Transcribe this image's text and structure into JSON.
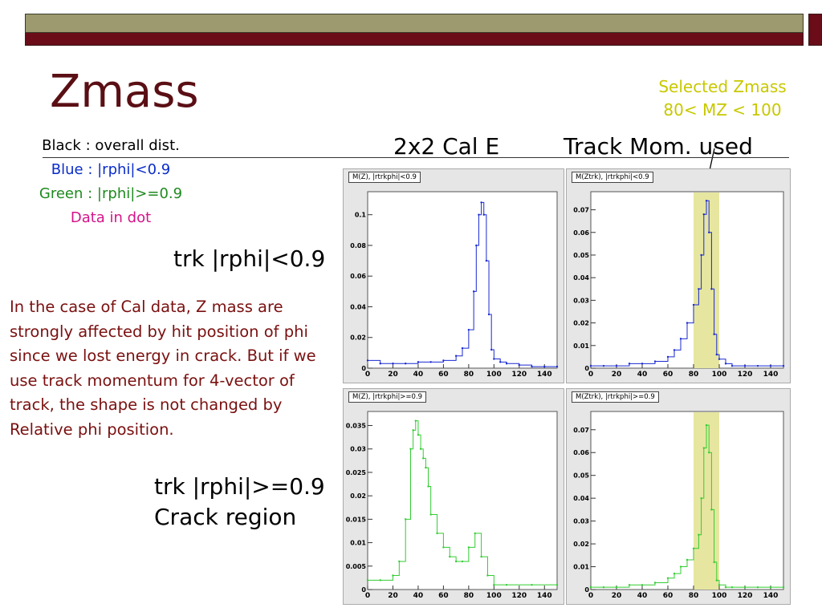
{
  "slide": {
    "title": "Zmass",
    "selected_note": [
      "Selected Zmass",
      "80< MZ < 100"
    ],
    "col1_header": "2x2 Cal E",
    "col2_header": "Track Mom. used",
    "row1_label": "trk |rphi|<0.9",
    "row2_label": [
      "trk |rphi|>=0.9",
      "Crack region"
    ],
    "legend": [
      {
        "text": "Black : overall dist.",
        "color": "#000000"
      },
      {
        "text": "Blue : |rphi|<0.9",
        "color": "#0a2cc8"
      },
      {
        "text": "Green : |rphi|>=0.9",
        "color": "#1f8a1f"
      },
      {
        "text": "Data in dot",
        "color": "#d4148a"
      }
    ],
    "paragraph": "In the case of Cal data, Z mass are strongly affected by hit position of phi since we lost energy in crack. But if we use track momentum for 4-vector of track, the shape is not changed by Relative phi position."
  },
  "colors": {
    "accent": "#5a0f14",
    "blue": "#1a2ad0",
    "green": "#33cc33",
    "band": "#e6e6a0"
  },
  "chart_data": [
    {
      "type": "line",
      "title": "M(Z), |rtrkphi|<0.9",
      "xticks": [
        0,
        20,
        40,
        60,
        80,
        100,
        120,
        140
      ],
      "xlim": [
        0,
        150
      ],
      "yticks": [
        "0",
        "0.02",
        "0.04",
        "0.06",
        "0.08",
        "0.1"
      ],
      "ylim": [
        0,
        0.115
      ],
      "band": null,
      "color": "#1a2ad0",
      "series": [
        {
          "x": [
            0,
            10,
            20,
            30,
            40,
            50,
            60,
            70,
            75,
            80,
            84,
            86,
            88,
            90,
            92,
            94,
            96,
            98,
            100,
            105,
            110,
            120,
            130,
            140,
            150
          ],
          "values": [
            0.005,
            0.003,
            0.003,
            0.003,
            0.004,
            0.004,
            0.005,
            0.008,
            0.013,
            0.025,
            0.05,
            0.08,
            0.1,
            0.108,
            0.1,
            0.07,
            0.035,
            0.012,
            0.006,
            0.004,
            0.003,
            0.002,
            0.001,
            0.001,
            0.001
          ]
        }
      ]
    },
    {
      "type": "line",
      "title": "M(Ztrk), |rtrkphi|<0.9",
      "xticks": [
        0,
        20,
        40,
        60,
        80,
        100,
        120,
        140
      ],
      "xlim": [
        0,
        150
      ],
      "yticks": [
        "0",
        "0.01",
        "0.02",
        "0.03",
        "0.04",
        "0.05",
        "0.06",
        "0.07"
      ],
      "ylim": [
        0,
        0.078
      ],
      "band": [
        80,
        100
      ],
      "color": "#1a2ad0",
      "series": [
        {
          "x": [
            0,
            10,
            20,
            30,
            40,
            50,
            60,
            65,
            70,
            75,
            80,
            84,
            86,
            88,
            90,
            92,
            94,
            96,
            98,
            100,
            105,
            110,
            120,
            130,
            140,
            150
          ],
          "values": [
            0.001,
            0.001,
            0.001,
            0.002,
            0.002,
            0.003,
            0.005,
            0.008,
            0.013,
            0.02,
            0.028,
            0.035,
            0.05,
            0.068,
            0.074,
            0.06,
            0.035,
            0.015,
            0.006,
            0.004,
            0.002,
            0.001,
            0.001,
            0.001,
            0.001,
            0.001
          ]
        }
      ]
    },
    {
      "type": "line",
      "title": "M(Z), |rtrkphi|>=0.9",
      "xticks": [
        0,
        20,
        40,
        60,
        80,
        100,
        120,
        140
      ],
      "xlim": [
        0,
        150
      ],
      "yticks": [
        "0",
        "0.005",
        "0.01",
        "0.015",
        "0.02",
        "0.025",
        "0.03",
        "0.035"
      ],
      "ylim": [
        0,
        0.038
      ],
      "band": null,
      "color": "#33cc33",
      "series": [
        {
          "x": [
            0,
            10,
            20,
            25,
            30,
            34,
            36,
            38,
            40,
            42,
            44,
            46,
            48,
            50,
            55,
            60,
            65,
            70,
            75,
            80,
            85,
            90,
            95,
            100,
            110,
            130,
            150
          ],
          "values": [
            0.002,
            0.002,
            0.003,
            0.006,
            0.015,
            0.03,
            0.034,
            0.036,
            0.033,
            0.03,
            0.028,
            0.026,
            0.022,
            0.016,
            0.012,
            0.009,
            0.007,
            0.006,
            0.006,
            0.009,
            0.012,
            0.007,
            0.003,
            0.001,
            0.001,
            0.001,
            0.001
          ]
        }
      ]
    },
    {
      "type": "line",
      "title": "M(Ztrk), |rtrkphi|>=0.9",
      "xticks": [
        0,
        20,
        40,
        60,
        80,
        100,
        120,
        140
      ],
      "xlim": [
        0,
        150
      ],
      "yticks": [
        "0",
        "0.01",
        "0.02",
        "0.03",
        "0.04",
        "0.05",
        "0.06",
        "0.07"
      ],
      "ylim": [
        0,
        0.078
      ],
      "band": [
        80,
        100
      ],
      "color": "#33cc33",
      "series": [
        {
          "x": [
            0,
            10,
            20,
            30,
            40,
            50,
            60,
            65,
            70,
            75,
            80,
            84,
            86,
            88,
            90,
            92,
            94,
            96,
            98,
            100,
            105,
            110,
            120,
            130,
            140,
            150
          ],
          "values": [
            0.001,
            0.001,
            0.001,
            0.002,
            0.002,
            0.003,
            0.005,
            0.007,
            0.01,
            0.013,
            0.018,
            0.024,
            0.04,
            0.062,
            0.072,
            0.06,
            0.035,
            0.012,
            0.004,
            0.002,
            0.001,
            0.001,
            0.001,
            0.001,
            0.001,
            0.001
          ]
        }
      ]
    }
  ]
}
